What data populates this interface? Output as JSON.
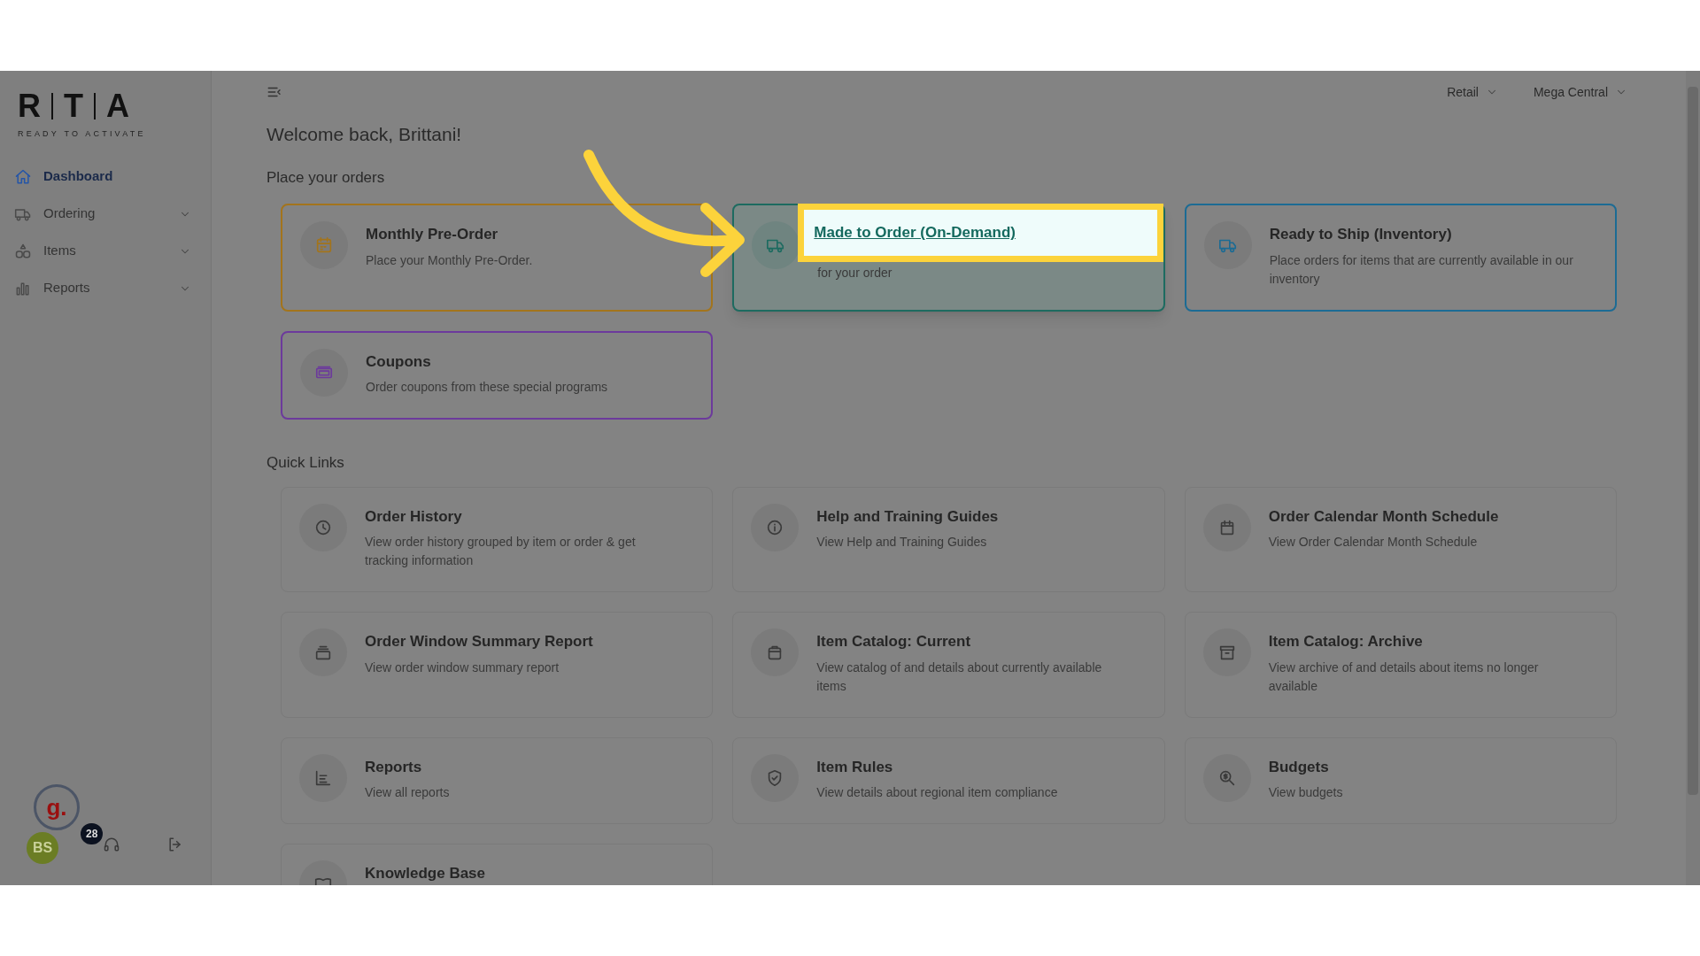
{
  "sidebar": {
    "logo": {
      "letters": [
        "R",
        "T",
        "A"
      ],
      "tagline": "READY TO ACTIVATE"
    },
    "items": [
      {
        "label": "Dashboard",
        "selected": true,
        "expandable": false
      },
      {
        "label": "Ordering",
        "selected": false,
        "expandable": true
      },
      {
        "label": "Items",
        "selected": false,
        "expandable": true
      },
      {
        "label": "Reports",
        "selected": false,
        "expandable": true
      }
    ],
    "user": {
      "initials": "BS"
    },
    "chat_widget": {
      "letter": "g.",
      "badge": "28"
    }
  },
  "header": {
    "selectors": [
      "Retail",
      "Mega Central"
    ]
  },
  "greeting": "Welcome back, Brittani!",
  "orders_section": {
    "title": "Place your orders",
    "cards": [
      {
        "title": "Monthly Pre-Order",
        "description": "Place your Monthly Pre-Order.",
        "color": "#a3741c",
        "highlighted": false
      },
      {
        "title": "Made to Order (On-Demand)",
        "description": "for your order",
        "color": "#1d6b60",
        "highlighted": true
      },
      {
        "title": "Ready to Ship (Inventory)",
        "description": "Place orders for items that are currently available in our inventory",
        "color": "#1c6b94",
        "highlighted": false
      },
      {
        "title": "Coupons",
        "description": "Order coupons from these special programs",
        "color": "#6c3a9c",
        "highlighted": false
      }
    ]
  },
  "quick_links": {
    "title": "Quick Links",
    "cards": [
      {
        "title": "Order History",
        "description": "View order history grouped by item or order & get tracking information"
      },
      {
        "title": "Help and Training Guides",
        "description": "View Help and Training Guides"
      },
      {
        "title": "Order Calendar Month Schedule",
        "description": "View Order Calendar Month Schedule"
      },
      {
        "title": "Order Window Summary Report",
        "description": "View order window summary report"
      },
      {
        "title": "Item Catalog: Current",
        "description": "View catalog of and details about currently available items"
      },
      {
        "title": "Item Catalog: Archive",
        "description": "View archive of and details about items no longer available"
      },
      {
        "title": "Reports",
        "description": "View all reports"
      },
      {
        "title": "Item Rules",
        "description": "View details about regional item compliance"
      },
      {
        "title": "Budgets",
        "description": "View budgets"
      },
      {
        "title": "Knowledge Base"
      }
    ]
  }
}
